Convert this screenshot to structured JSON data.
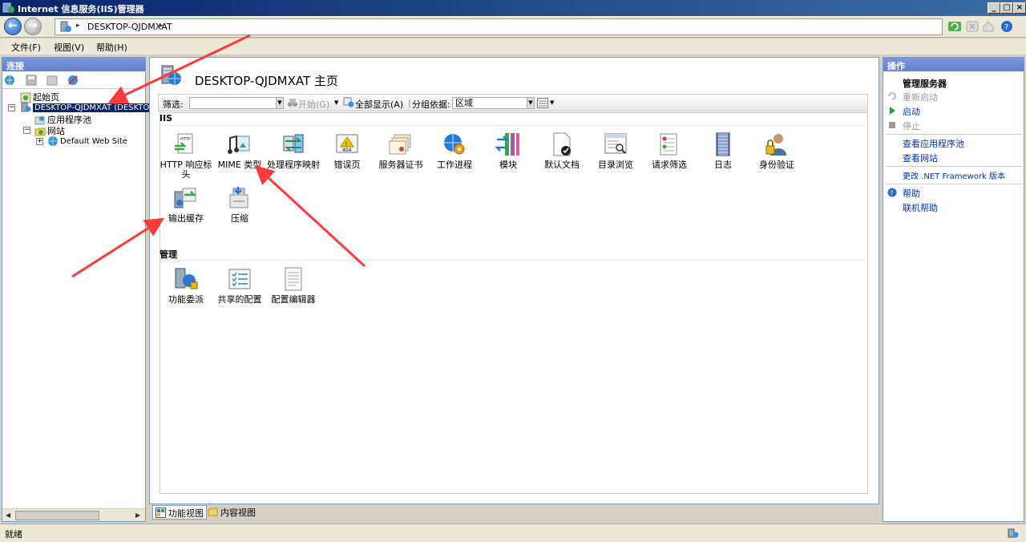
{
  "window": {
    "title": "Internet 信息服务(IIS)管理器",
    "controls": [
      "_",
      "□",
      "×"
    ]
  },
  "address": {
    "crumb": "DESKTOP-QJDMXAT",
    "separator": "▸"
  },
  "menubar": {
    "items": [
      "文件(F)",
      "视图(V)",
      "帮助(H)"
    ]
  },
  "connections": {
    "header": "连接",
    "tree": {
      "start_page": "起始页",
      "server": "DESKTOP-QJDMXAT (DESKTOP-Q",
      "app_pools": "应用程序池",
      "sites": "网站",
      "default_site": "Default Web Site"
    }
  },
  "center": {
    "page_title": "DESKTOP-QJDMXAT 主页",
    "filter": {
      "label": "筛选:",
      "start": "开始(G)",
      "show_all": "全部显示(A)",
      "group_by_label": "分组依据:",
      "group_by_value": "区域"
    },
    "sections": {
      "iis": "IIS",
      "management": "管理"
    },
    "iis_features": [
      "HTTP 响应标头",
      "MIME 类型",
      "处理程序映射",
      "错误页",
      "服务器证书",
      "工作进程",
      "模块",
      "默认文档",
      "目录浏览",
      "请求筛选",
      "日志",
      "身份验证",
      "输出缓存",
      "压缩"
    ],
    "management_features": [
      "功能委派",
      "共享的配置",
      "配置编辑器"
    ],
    "view_tabs": {
      "features": "功能视图",
      "content": "内容视图"
    }
  },
  "actions": {
    "header": "操作",
    "manage_server_title": "管理服务器",
    "restart": "重新启动",
    "start": "启动",
    "stop": "停止",
    "view_app_pools": "查看应用程序池",
    "view_sites": "查看网站",
    "change_net": "更改 .NET Framework 版本",
    "help": "帮助",
    "online_help": "联机帮助"
  },
  "status": {
    "text": "就绪"
  },
  "colors": {
    "title_bar": "#0a246a",
    "selection": "#0a246a",
    "link": "#0033aa",
    "annotation_arrow": "#ff3b3b"
  }
}
